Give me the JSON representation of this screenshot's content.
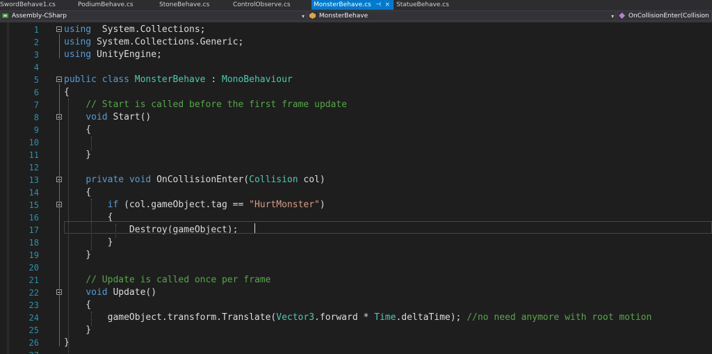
{
  "tabs": [
    {
      "label": "SwordBehave1.cs",
      "active": false
    },
    {
      "label": "PodiumBehave.cs",
      "active": false
    },
    {
      "label": "StoneBehave.cs",
      "active": false
    },
    {
      "label": "ControlObserve.cs",
      "active": false
    },
    {
      "label": "MonsterBehave.cs",
      "active": true
    },
    {
      "label": "StatueBehave.cs",
      "active": false
    }
  ],
  "nav": {
    "project": "Assembly-CSharp",
    "class": "MonsterBehave",
    "member": "OnCollisionEnter(Collision col)"
  },
  "icons": {
    "pin": "pin-icon",
    "close": "close-icon",
    "dropdown": "chevron-down-icon"
  },
  "colors": {
    "keyword": "#569cd6",
    "type": "#4ec9b0",
    "comment": "#57a64a",
    "string": "#d69d85",
    "line_number": "#2b91af",
    "active_tab": "#007acc"
  },
  "editor": {
    "lines": [
      [
        [
          "kw",
          "using"
        ],
        [
          "",
          "  System.Collections;"
        ]
      ],
      [
        [
          "kw",
          "using"
        ],
        [
          "",
          " System.Collections.Generic;"
        ]
      ],
      [
        [
          "kw",
          "using"
        ],
        [
          "",
          " UnityEngine;"
        ]
      ],
      [],
      [
        [
          "kw",
          "public"
        ],
        [
          "",
          " "
        ],
        [
          "kw",
          "class"
        ],
        [
          "",
          " "
        ],
        [
          "ty",
          "MonsterBehave"
        ],
        [
          "",
          " : "
        ],
        [
          "ty",
          "MonoBehaviour"
        ]
      ],
      [
        [
          "",
          "{"
        ]
      ],
      [
        [
          "",
          "    "
        ],
        [
          "cm",
          "// Start is called before the first frame update"
        ]
      ],
      [
        [
          "",
          "    "
        ],
        [
          "kw",
          "void"
        ],
        [
          "",
          " Start()"
        ]
      ],
      [
        [
          "",
          "    {"
        ]
      ],
      [],
      [
        [
          "",
          "    }"
        ]
      ],
      [],
      [
        [
          "",
          "    "
        ],
        [
          "kw",
          "private"
        ],
        [
          "",
          " "
        ],
        [
          "kw",
          "void"
        ],
        [
          "",
          " OnCollisionEnter("
        ],
        [
          "ty",
          "Collision"
        ],
        [
          "",
          " col)"
        ]
      ],
      [
        [
          "",
          "    {"
        ]
      ],
      [
        [
          "",
          "        "
        ],
        [
          "kw",
          "if"
        ],
        [
          "",
          " (col.gameObject.tag == "
        ],
        [
          "st",
          "\"HurtMonster\""
        ],
        [
          "",
          ")"
        ]
      ],
      [
        [
          "",
          "        {"
        ]
      ],
      [
        [
          "",
          "            Destroy(gameObject);"
        ]
      ],
      [
        [
          "",
          "        }"
        ]
      ],
      [
        [
          "",
          "    }"
        ]
      ],
      [],
      [
        [
          "",
          "    "
        ],
        [
          "cm",
          "// Update is called once per frame"
        ]
      ],
      [
        [
          "",
          "    "
        ],
        [
          "kw",
          "void"
        ],
        [
          "",
          " Update()"
        ]
      ],
      [
        [
          "",
          "    {"
        ]
      ],
      [
        [
          "",
          "        gameObject.transform.Translate("
        ],
        [
          "ty",
          "Vector3"
        ],
        [
          "",
          ".forward * "
        ],
        [
          "ty",
          "Time"
        ],
        [
          "",
          ".deltaTime); "
        ],
        [
          "cm",
          "//no need anymore with root motion"
        ]
      ],
      [
        [
          "",
          "    }"
        ]
      ],
      [
        [
          "",
          "}"
        ]
      ],
      []
    ]
  }
}
